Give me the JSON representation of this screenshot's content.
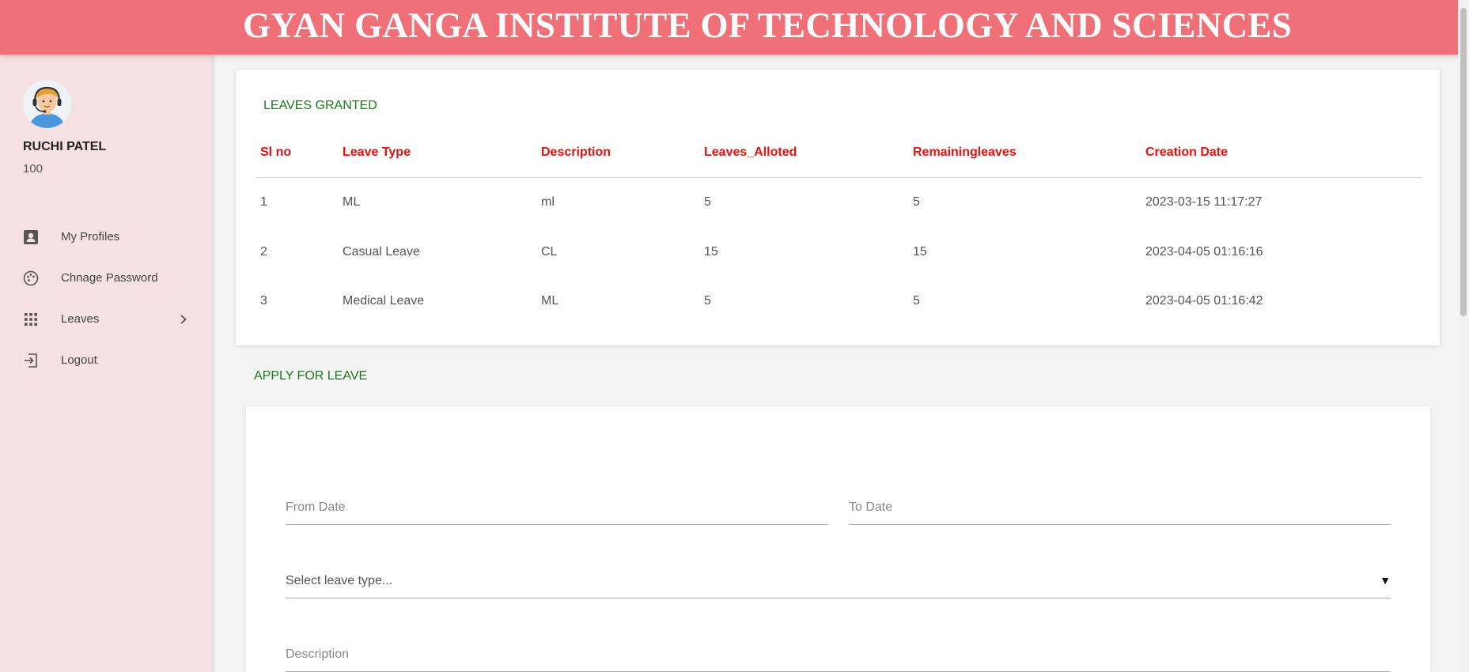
{
  "header": {
    "title": "GYAN GANGA INSTITUTE OF TECHNOLOGY AND SCIENCES"
  },
  "colors": {
    "header_bg": "#f07078",
    "sidebar_bg": "#f5e0e2",
    "table_header": "#e81010",
    "section_title": "#1a7a1a"
  },
  "sidebar": {
    "user": {
      "name": "RUCHI PATEL",
      "id": "100",
      "avatar_icon": "avatar-headset-icon"
    },
    "items": [
      {
        "label": "My Profiles",
        "icon": "profile-icon"
      },
      {
        "label": "Chnage Password",
        "icon": "palette-icon"
      },
      {
        "label": "Leaves",
        "icon": "grid-icon",
        "has_submenu": true
      },
      {
        "label": "Logout",
        "icon": "logout-icon"
      }
    ]
  },
  "leaves": {
    "title": "LEAVES GRANTED",
    "columns": [
      "Sl no",
      "Leave Type",
      "Description",
      "Leaves_Alloted",
      "Remainingleaves",
      "Creation Date"
    ],
    "rows": [
      [
        "1",
        "ML",
        "ml",
        "5",
        "5",
        "2023-03-15 11:17:27"
      ],
      [
        "2",
        "Casual Leave",
        "CL",
        "15",
        "15",
        "2023-04-05 01:16:16"
      ],
      [
        "3",
        "Medical Leave",
        "ML",
        "5",
        "5",
        "2023-04-05 01:16:42"
      ]
    ]
  },
  "apply": {
    "title": "APPLY FOR LEAVE",
    "from_date_label": "From Date",
    "to_date_label": "To Date",
    "leave_type_placeholder": "Select leave type...",
    "leave_type_arrow": "▼",
    "description_label": "Description"
  }
}
